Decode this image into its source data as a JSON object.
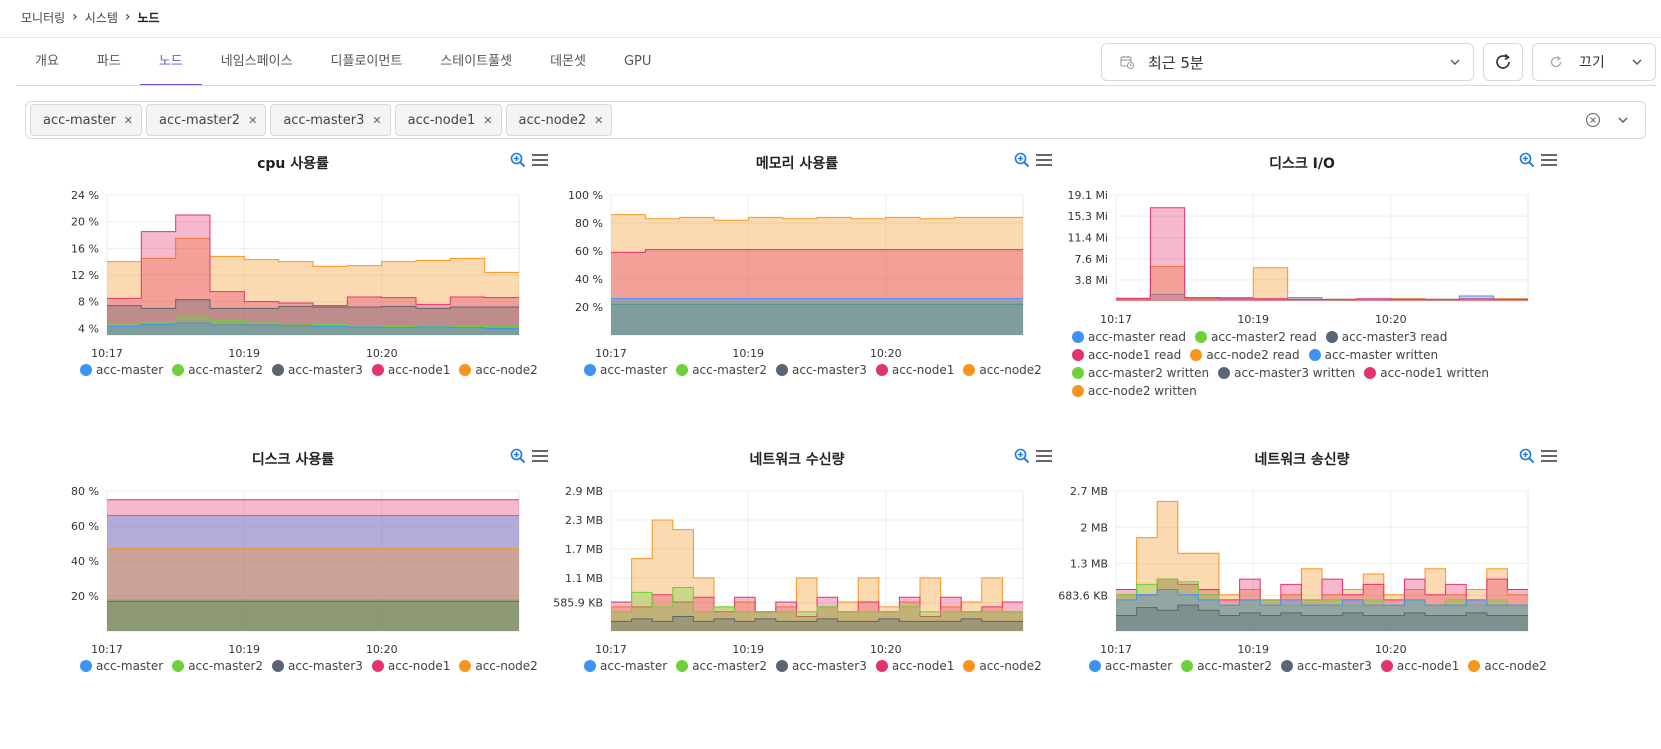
{
  "breadcrumb": {
    "items": [
      "모니터링",
      "시스템",
      "노드"
    ]
  },
  "tabs": [
    "개요",
    "파드",
    "노드",
    "네임스페이스",
    "디플로이먼트",
    "스테이트풀셋",
    "데몬셋",
    "GPU"
  ],
  "active_tab": "노드",
  "controls": {
    "time_range": "최근 5분",
    "auto_refresh": "끄기"
  },
  "filter": {
    "selected_nodes": [
      "acc-master",
      "acc-master2",
      "acc-master3",
      "acc-node1",
      "acc-node2"
    ]
  },
  "colors": {
    "acc-master": "#3b93f4",
    "acc-master2": "#6ed03a",
    "acc-master3": "#5a6673",
    "acc-node1": "#e3336e",
    "acc-node2": "#f7951f",
    "accent": "#7b4ce0"
  },
  "chart_data": [
    {
      "title": "cpu 사용률",
      "type": "area",
      "stacked": true,
      "x_ticks": [
        "10:17",
        "10:19",
        "10:20"
      ],
      "y_ticks": [
        "24 %",
        "20 %",
        "16 %",
        "12 %",
        "8 %",
        "4 %"
      ],
      "ylim": [
        3,
        24
      ],
      "series": [
        {
          "name": "acc-master",
          "values": [
            4.3,
            4.6,
            4.8,
            4.5,
            4.5,
            4.4,
            4.3,
            4.2,
            4.1,
            4.2,
            4.1,
            4.0
          ]
        },
        {
          "name": "acc-master2",
          "values": [
            4.5,
            5.0,
            5.7,
            5.2,
            4.8,
            4.5,
            4.6,
            4.4,
            4.3,
            4.3,
            4.3,
            4.3
          ]
        },
        {
          "name": "acc-master3",
          "values": [
            7.4,
            7.0,
            8.3,
            7.0,
            7.0,
            7.3,
            7.2,
            7.2,
            7.3,
            7.0,
            7.2,
            7.2
          ]
        },
        {
          "name": "acc-node1",
          "values": [
            8.5,
            18.5,
            21.0,
            9.5,
            8.0,
            7.8,
            7.4,
            8.7,
            8.6,
            7.6,
            8.7,
            8.6
          ]
        },
        {
          "name": "acc-node2",
          "values": [
            14.0,
            14.5,
            17.5,
            14.8,
            14.3,
            14.0,
            13.3,
            13.4,
            14.0,
            14.2,
            14.5,
            12.4
          ]
        }
      ],
      "legend": [
        "acc-master",
        "acc-master2",
        "acc-master3",
        "acc-node1",
        "acc-node2"
      ]
    },
    {
      "title": "메모리 사용률",
      "type": "area",
      "stacked": true,
      "x_ticks": [
        "10:17",
        "10:19",
        "10:20"
      ],
      "y_ticks": [
        "100 %",
        "80 %",
        "60 %",
        "40 %",
        "20 %"
      ],
      "ylim": [
        0,
        100
      ],
      "series": [
        {
          "name": "acc-master",
          "values": [
            26,
            26,
            26,
            26,
            26,
            26,
            26,
            26,
            26,
            26,
            26,
            26
          ]
        },
        {
          "name": "acc-master2",
          "values": [
            24,
            24,
            24,
            24,
            24,
            24,
            24,
            24,
            24,
            24,
            24,
            24
          ]
        },
        {
          "name": "acc-master3",
          "values": [
            22,
            22,
            22,
            22,
            22,
            22,
            22,
            22,
            22,
            22,
            22,
            22
          ]
        },
        {
          "name": "acc-node1",
          "values": [
            59,
            61,
            61,
            61,
            61,
            61,
            61,
            61,
            61,
            61,
            61,
            61
          ]
        },
        {
          "name": "acc-node2",
          "values": [
            86,
            83,
            84,
            82,
            84,
            83,
            84,
            83,
            84,
            83,
            84,
            84
          ]
        }
      ],
      "legend": [
        "acc-master",
        "acc-master2",
        "acc-master3",
        "acc-node1",
        "acc-node2"
      ]
    },
    {
      "title": "디스크 I/O",
      "type": "area",
      "x_ticks": [
        "10:17",
        "10:19",
        "10:20"
      ],
      "y_ticks": [
        "19.1 Mi",
        "15.3 Mi",
        "11.4 Mi",
        "7.6 Mi",
        "3.8 Mi"
      ],
      "ylim": [
        0,
        19.1
      ],
      "series": [
        {
          "name": "acc-node1 read",
          "values": [
            0.5,
            16.8,
            0.6,
            0.4,
            0.4,
            0.3,
            0.3,
            0.4,
            0.3,
            0.3,
            0.4,
            0.3
          ]
        },
        {
          "name": "acc-node2 read",
          "values": [
            0.4,
            6.2,
            0.5,
            0.3,
            6.0,
            0.3,
            0.3,
            0.3,
            0.4,
            0.3,
            0.3,
            0.4
          ]
        },
        {
          "name": "acc-master read",
          "values": [
            0.3,
            1.2,
            0.4,
            0.6,
            0.3,
            0.6,
            0.3,
            0.3,
            0.4,
            0.3,
            0.9,
            0.3
          ]
        }
      ],
      "legend": [
        "acc-master read",
        "acc-master2 read",
        "acc-master3 read",
        "acc-node1 read",
        "acc-node2 read",
        "acc-master written",
        "acc-master2 written",
        "acc-master3 written",
        "acc-node1 written",
        "acc-node2 written"
      ],
      "legend_colors": [
        "#3b93f4",
        "#6ed03a",
        "#5a6673",
        "#e3336e",
        "#f7951f",
        "#3b93f4",
        "#6ed03a",
        "#5a6673",
        "#e3336e",
        "#f7951f"
      ]
    },
    {
      "title": "디스크 사용률",
      "type": "area",
      "stacked": true,
      "x_ticks": [
        "10:17",
        "10:19",
        "10:20"
      ],
      "y_ticks": [
        "80 %",
        "60 %",
        "40 %",
        "20 %"
      ],
      "ylim": [
        0,
        80
      ],
      "series": [
        {
          "name": "acc-master3",
          "values": [
            17,
            17,
            17,
            17,
            17,
            17,
            17,
            17,
            17,
            17,
            17,
            17
          ]
        },
        {
          "name": "acc-master2",
          "values": [
            18,
            18,
            18,
            18,
            18,
            18,
            18,
            18,
            18,
            18,
            18,
            18
          ]
        },
        {
          "name": "acc-node2",
          "values": [
            47,
            47,
            47,
            47,
            47,
            47,
            47,
            47,
            47,
            47,
            47,
            47
          ]
        },
        {
          "name": "acc-master",
          "values": [
            66,
            66,
            66,
            66,
            66,
            66,
            66,
            66,
            66,
            66,
            66,
            66
          ]
        },
        {
          "name": "acc-node1",
          "values": [
            75,
            75,
            75,
            75,
            75,
            75,
            75,
            75,
            75,
            75,
            75,
            75
          ]
        }
      ],
      "legend": [
        "acc-master",
        "acc-master2",
        "acc-master3",
        "acc-node1",
        "acc-node2"
      ]
    },
    {
      "title": "네트워크 수신량",
      "type": "area",
      "x_ticks": [
        "10:17",
        "10:19",
        "10:20"
      ],
      "y_ticks": [
        "2.9 MB",
        "2.3 MB",
        "1.7 MB",
        "1.1 MB",
        "585.9 KB"
      ],
      "ylim": [
        0,
        2.9
      ],
      "series": [
        {
          "name": "acc-master3",
          "values": [
            0.2,
            0.25,
            0.2,
            0.3,
            0.2,
            0.25,
            0.2,
            0.25,
            0.2,
            0.2,
            0.25,
            0.2,
            0.2,
            0.25,
            0.2,
            0.2,
            0.2,
            0.25,
            0.2,
            0.2
          ]
        },
        {
          "name": "acc-master2",
          "values": [
            0.4,
            0.8,
            0.5,
            0.9,
            0.4,
            0.5,
            0.4,
            0.4,
            0.4,
            0.4,
            0.5,
            0.4,
            0.4,
            0.4,
            0.5,
            0.4,
            0.4,
            0.4,
            0.4,
            0.4
          ]
        },
        {
          "name": "acc-node1",
          "values": [
            0.6,
            0.5,
            0.75,
            0.6,
            0.7,
            0.4,
            0.7,
            0.4,
            0.6,
            0.3,
            0.7,
            0.4,
            0.6,
            0.4,
            0.7,
            0.3,
            0.7,
            0.4,
            0.5,
            0.6
          ]
        },
        {
          "name": "acc-node2",
          "values": [
            0.5,
            1.5,
            2.3,
            2.1,
            1.1,
            0.5,
            0.6,
            0.4,
            0.5,
            1.1,
            0.5,
            0.6,
            1.1,
            0.5,
            0.6,
            1.1,
            0.5,
            0.6,
            1.1,
            0.4
          ]
        }
      ],
      "legend": [
        "acc-master",
        "acc-master2",
        "acc-master3",
        "acc-node1",
        "acc-node2"
      ]
    },
    {
      "title": "네트워크 송신량",
      "type": "area",
      "x_ticks": [
        "10:17",
        "10:19",
        "10:20"
      ],
      "y_ticks": [
        "2.7 MB",
        "2 MB",
        "1.3 MB",
        "683.6 KB"
      ],
      "ylim": [
        0,
        2.7
      ],
      "series": [
        {
          "name": "acc-master3",
          "values": [
            0.3,
            0.45,
            0.4,
            0.5,
            0.4,
            0.3,
            0.35,
            0.3,
            0.35,
            0.3,
            0.3,
            0.35,
            0.3,
            0.3,
            0.35,
            0.3,
            0.3,
            0.35,
            0.3,
            0.3
          ]
        },
        {
          "name": "acc-master",
          "values": [
            0.6,
            0.7,
            0.8,
            0.7,
            0.6,
            0.5,
            0.6,
            0.5,
            0.6,
            0.5,
            0.5,
            0.6,
            0.5,
            0.5,
            0.6,
            0.5,
            0.5,
            0.6,
            0.5,
            0.5
          ]
        },
        {
          "name": "acc-master2",
          "values": [
            0.7,
            0.9,
            1.0,
            0.95,
            0.7,
            0.5,
            0.6,
            0.6,
            0.5,
            0.6,
            0.6,
            0.5,
            0.6,
            0.5,
            0.6,
            0.5,
            0.6,
            0.5,
            0.6,
            0.5
          ]
        },
        {
          "name": "acc-node1",
          "values": [
            0.8,
            0.7,
            1.0,
            0.9,
            0.8,
            0.6,
            1.0,
            0.6,
            0.9,
            0.6,
            1.0,
            0.7,
            0.9,
            0.6,
            1.0,
            0.7,
            0.9,
            0.6,
            1.0,
            0.8
          ]
        },
        {
          "name": "acc-node2",
          "values": [
            0.7,
            1.8,
            2.5,
            1.5,
            1.5,
            0.7,
            0.8,
            0.6,
            0.7,
            1.2,
            0.7,
            0.8,
            1.1,
            0.7,
            0.8,
            1.2,
            0.7,
            0.8,
            1.2,
            0.7
          ]
        }
      ],
      "legend": [
        "acc-master",
        "acc-master2",
        "acc-master3",
        "acc-node1",
        "acc-node2"
      ]
    }
  ]
}
